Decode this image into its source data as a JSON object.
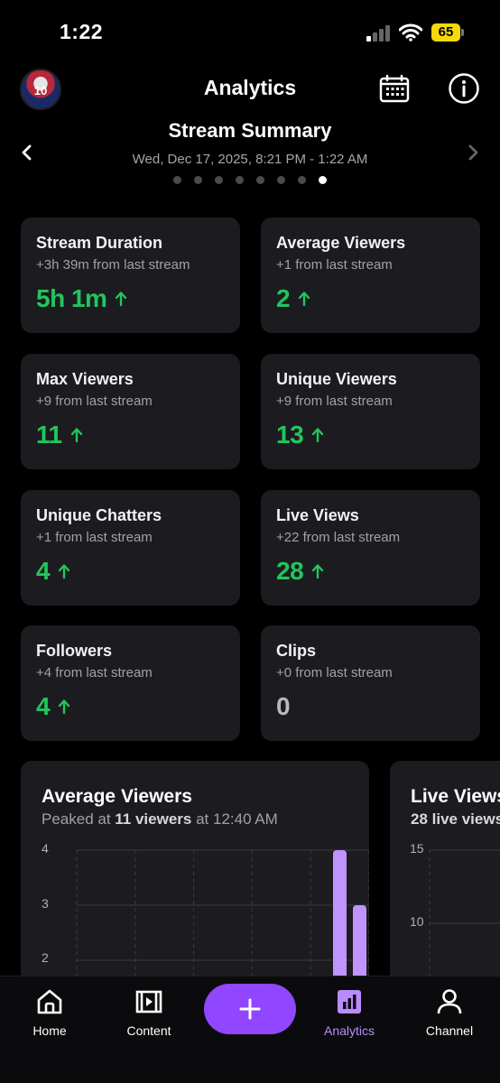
{
  "status_bar": {
    "time": "1:22",
    "battery": "65"
  },
  "header": {
    "title": "Analytics",
    "avatar_number": "10",
    "calendar_icon": "calendar-icon",
    "info_icon": "info-icon"
  },
  "summary": {
    "title": "Stream Summary",
    "date_range": "Wed, Dec 17, 2025, 8:21 PM - 1:22 AM",
    "page_count": 8,
    "active_page": 8
  },
  "stats": [
    {
      "label": "Stream Duration",
      "change": "+3h 39m from last stream",
      "value": "5h 1m",
      "trend": "up"
    },
    {
      "label": "Average Viewers",
      "change": "+1 from last stream",
      "value": "2",
      "trend": "up"
    },
    {
      "label": "Max Viewers",
      "change": "+9 from last stream",
      "value": "11",
      "trend": "up"
    },
    {
      "label": "Unique Viewers",
      "change": "+9 from last stream",
      "value": "13",
      "trend": "up"
    },
    {
      "label": "Unique Chatters",
      "change": "+1 from last stream",
      "value": "4",
      "trend": "up"
    },
    {
      "label": "Live Views",
      "change": "+22 from last stream",
      "value": "28",
      "trend": "up"
    },
    {
      "label": "Followers",
      "change": "+4 from last stream",
      "value": "4",
      "trend": "up"
    },
    {
      "label": "Clips",
      "change": "+0 from last stream",
      "value": "0",
      "trend": "none"
    }
  ],
  "charts": {
    "average_viewers": {
      "title": "Average Viewers",
      "sub_prefix": "Peaked at ",
      "sub_bold": "11 viewers",
      "sub_suffix": " at 12:40 AM",
      "yticks": [
        "4",
        "3",
        "2"
      ]
    },
    "live_views": {
      "title": "Live Views",
      "sub_bold": "28 live views",
      "yticks": [
        "15",
        "10"
      ]
    }
  },
  "chart_data": [
    {
      "type": "bar",
      "title": "Average Viewers",
      "ylim": [
        0,
        4
      ],
      "yticks": [
        2,
        3,
        4
      ],
      "grid": true,
      "values_visible": [
        4,
        3
      ],
      "color": "#bf94ff"
    },
    {
      "type": "bar",
      "title": "Live Views",
      "yticks": [
        10,
        15
      ],
      "grid": true
    }
  ],
  "tabbar": {
    "items": [
      {
        "label": "Home",
        "icon": "home-icon"
      },
      {
        "label": "Content",
        "icon": "content-icon"
      },
      {
        "label": "Analytics",
        "icon": "analytics-icon",
        "active": true
      },
      {
        "label": "Channel",
        "icon": "user-icon"
      }
    ],
    "create_icon": "plus-icon"
  },
  "colors": {
    "accent": "#9146ff",
    "positive": "#22c55e",
    "card": "#1c1c20",
    "bar": "#bf94ff"
  }
}
